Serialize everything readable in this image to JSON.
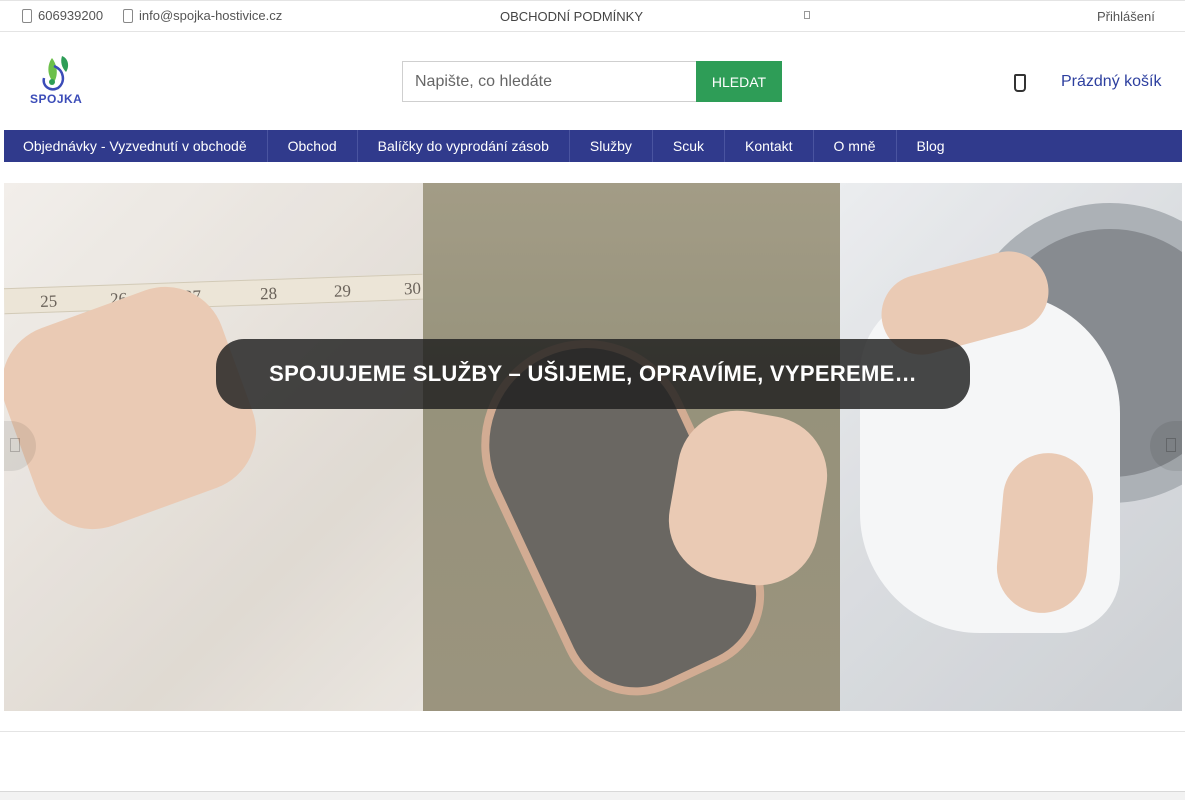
{
  "topbar": {
    "phone": "606939200",
    "email": "info@spojka-hostivice.cz",
    "terms": "Obchodní podmínky",
    "login": "Přihlášení"
  },
  "header": {
    "logo_text": "SPOJKA",
    "search_placeholder": "Napište, co hledáte",
    "search_button": "Hledat",
    "cart_label": "Prázdný košík"
  },
  "nav": {
    "items": [
      {
        "label": "Objednávky - Vyzvednutí v obchodě"
      },
      {
        "label": "Obchod"
      },
      {
        "label": "Balíčky do vyprodání zásob"
      },
      {
        "label": "Služby"
      },
      {
        "label": "Scuk"
      },
      {
        "label": "Kontakt"
      },
      {
        "label": "O mně"
      },
      {
        "label": "Blog"
      }
    ]
  },
  "hero": {
    "banner_text": "SPOJUJEME SLUŽBY – UŠIJEME, OPRAVÍME, VYPEREME…",
    "tape_numbers": [
      "25",
      "26",
      "27",
      "28",
      "29",
      "30"
    ]
  },
  "colors": {
    "nav_bg": "#303a8c",
    "accent_green": "#2e9d57",
    "link_blue": "#2d3f9f"
  }
}
